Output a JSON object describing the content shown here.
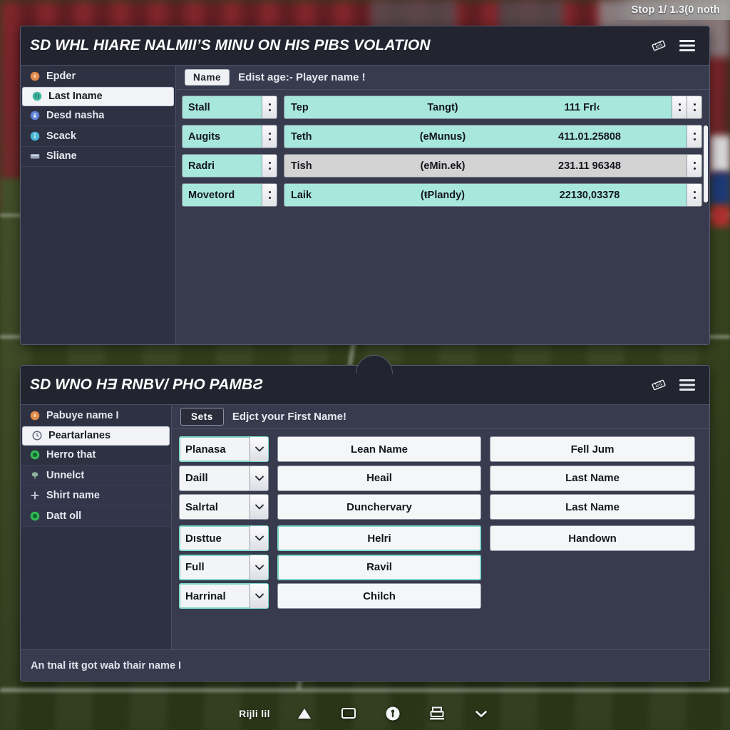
{
  "top_status": {
    "text": "Stop 1/  1.3(0 noth"
  },
  "panel_one": {
    "title": "SD WHL HIARE NALMII’S MINU ON HIS PIBS VOLATION",
    "header_icons": [
      {
        "name": "ticket-icon"
      },
      {
        "name": "hamburger-menu-icon"
      }
    ],
    "sidebar": [
      {
        "label": "Epder",
        "icon": "orange-circle-icon",
        "color": "#e08a4a",
        "selected": false
      },
      {
        "label": "Last Iname",
        "icon": "teal-circle-icon",
        "color": "#3fb9a4",
        "selected": true
      },
      {
        "label": "Desd nasha",
        "icon": "blue-lock-icon",
        "color": "#5b7fd4",
        "selected": false
      },
      {
        "label": "Scack",
        "icon": "info-circle-icon",
        "color": "#4bb6d8",
        "selected": false
      },
      {
        "label": "Sliane",
        "icon": "card-icon",
        "color": "#9aa4bb",
        "selected": false
      }
    ],
    "tab": {
      "label": "Name",
      "hint": "Edist age:- Player name !"
    },
    "rows": [
      {
        "combo": "Stall",
        "combo_grey": false,
        "a": "Tep",
        "b": "Tangt)",
        "c": "111 Frl‹",
        "grey": false,
        "double_spin": true
      },
      {
        "combo": "Augits",
        "combo_grey": false,
        "a": "Teth",
        "b": "(eMunus)",
        "c": "411.01.25808",
        "grey": false,
        "double_spin": false
      },
      {
        "combo": "Radri",
        "combo_grey": false,
        "a": "Tish",
        "b": "(eMin.ek)",
        "c": "231.11 96348",
        "grey": true,
        "double_spin": false
      },
      {
        "combo": "Movetord",
        "combo_grey": false,
        "a": "Laik",
        "b": "(ŧPlandy)",
        "c": "22130,03378",
        "grey": false,
        "double_spin": false
      }
    ]
  },
  "panel_two": {
    "title": "SD WNO HƎ RNBV/ PHO PAMBƧ",
    "header_icons": [
      {
        "name": "ticket-icon"
      },
      {
        "name": "hamburger-menu-icon"
      }
    ],
    "sidebar": [
      {
        "label": "Pabuye name I",
        "icon": "orange-circle-icon",
        "color": "#e08a4a",
        "selected": false,
        "grouped": false
      },
      {
        "label": "Peartarlanes",
        "icon": "clock-circle-icon",
        "color": "#6f7686",
        "selected": true,
        "grouped": false
      },
      {
        "label": "Herro that",
        "icon": "green-circle-icon",
        "color": "#34b857",
        "selected": false,
        "grouped": false
      },
      {
        "label": "Unnelct",
        "icon": "tree-icon",
        "color": "#93b3a2",
        "selected": false,
        "grouped": true
      },
      {
        "label": "Shirt name",
        "icon": "plus-icon",
        "color": "#c9cedd",
        "selected": false,
        "grouped": true
      },
      {
        "label": "Datt oll",
        "icon": "green-circle-icon",
        "color": "#34b857",
        "selected": false,
        "grouped": true
      }
    ],
    "tab": {
      "label": "Sets",
      "hint": "Edjct your First Name!"
    },
    "rows": [
      {
        "select": "Planasa",
        "select_hl": true,
        "mid": "Lean Name",
        "mid_hl": false,
        "right": "Fell Jum",
        "right_show": true,
        "gap": false
      },
      {
        "select": "Daill",
        "select_hl": false,
        "mid": "Heail",
        "mid_hl": false,
        "right": "Last Name",
        "right_show": true,
        "gap": false
      },
      {
        "select": "Salrtal",
        "select_hl": false,
        "mid": "Dunchervary",
        "mid_hl": false,
        "right": "Last Name",
        "right_show": true,
        "gap": false
      },
      {
        "select": "Dısttue",
        "select_hl": true,
        "mid": "Helri",
        "mid_hl": true,
        "right": "Handown",
        "right_show": true,
        "gap": true
      },
      {
        "select": "Full",
        "select_hl": true,
        "mid": "Ravil",
        "mid_hl": true,
        "right": "",
        "right_show": false,
        "gap": false
      },
      {
        "select": "Harrinal",
        "select_hl": true,
        "mid": "Chilch",
        "mid_hl": false,
        "right": "",
        "right_show": false,
        "gap": false
      }
    ],
    "status_text": "An tnal itŧ got wab thair name I"
  },
  "taskbar": {
    "label": "Rĳli lil",
    "icons": [
      {
        "name": "triangle-up-icon"
      },
      {
        "name": "monitor-icon"
      },
      {
        "name": "circle-key-icon"
      },
      {
        "name": "printer-tray-icon"
      },
      {
        "name": "chevron-down-icon"
      }
    ]
  },
  "colors": {
    "panel_bg": "#373b4d",
    "header_bg": "#22242f",
    "accent_mint": "#a8e8dc",
    "accent_grey": "#d3d3d3",
    "pitch_green": "#36441f"
  }
}
